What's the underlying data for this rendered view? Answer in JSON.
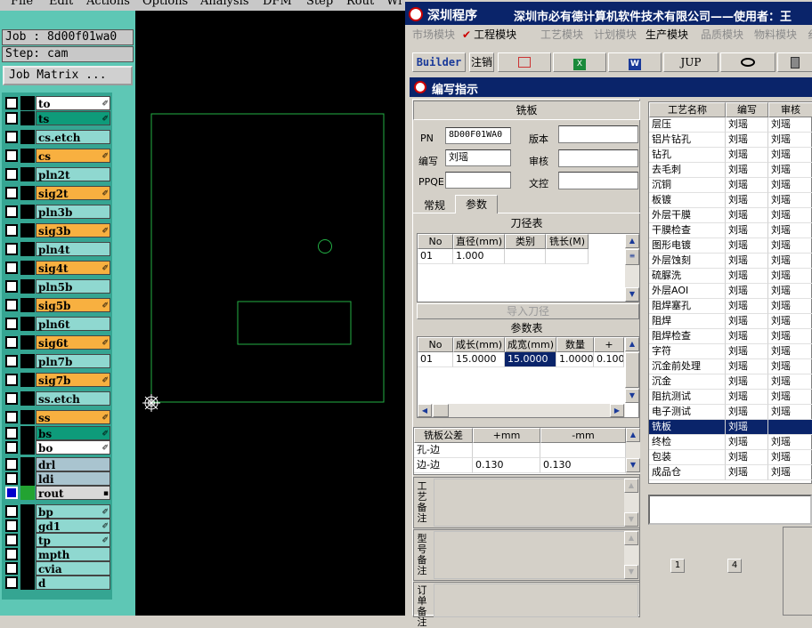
{
  "left_app": {
    "menu": [
      "File",
      "Edit",
      "Actions",
      "Options",
      "Analysis",
      "DFM",
      "Step",
      "Rout",
      "Wi"
    ],
    "job_line": "Job : 8d00f01wa0",
    "step_line": "Step: cam",
    "job_matrix_label": "Job Matrix ...",
    "layers": [
      {
        "name": "to",
        "color": "#ffffff",
        "swatch": "#000000",
        "icon": "✐",
        "checked": false
      },
      {
        "name": "ts",
        "color": "#0e9b7a",
        "swatch": "#000000",
        "icon": "✐",
        "checked": false
      },
      {
        "name": "cs.etch",
        "color": "#8fd8d0",
        "swatch": "#000000",
        "icon": "",
        "checked": false
      },
      {
        "name": "cs",
        "color": "#f8b040",
        "swatch": "#000000",
        "icon": "✐",
        "checked": false
      },
      {
        "name": "pln2t",
        "color": "#8fd8d0",
        "swatch": "#000000",
        "icon": "",
        "checked": false
      },
      {
        "name": "sig2t",
        "color": "#f8b040",
        "swatch": "#000000",
        "icon": "✐",
        "checked": false
      },
      {
        "name": "pln3b",
        "color": "#8fd8d0",
        "swatch": "#000000",
        "icon": "",
        "checked": false
      },
      {
        "name": "sig3b",
        "color": "#f8b040",
        "swatch": "#000000",
        "icon": "✐",
        "checked": false
      },
      {
        "name": "pln4t",
        "color": "#8fd8d0",
        "swatch": "#000000",
        "icon": "",
        "checked": false
      },
      {
        "name": "sig4t",
        "color": "#f8b040",
        "swatch": "#000000",
        "icon": "✐",
        "checked": false
      },
      {
        "name": "pln5b",
        "color": "#8fd8d0",
        "swatch": "#000000",
        "icon": "",
        "checked": false
      },
      {
        "name": "sig5b",
        "color": "#f8b040",
        "swatch": "#000000",
        "icon": "✐",
        "checked": false
      },
      {
        "name": "pln6t",
        "color": "#8fd8d0",
        "swatch": "#000000",
        "icon": "",
        "checked": false
      },
      {
        "name": "sig6t",
        "color": "#f8b040",
        "swatch": "#000000",
        "icon": "✐",
        "checked": false
      },
      {
        "name": "pln7b",
        "color": "#8fd8d0",
        "swatch": "#000000",
        "icon": "",
        "checked": false
      },
      {
        "name": "sig7b",
        "color": "#f8b040",
        "swatch": "#000000",
        "icon": "✐",
        "checked": false
      },
      {
        "name": "ss.etch",
        "color": "#8fd8d0",
        "swatch": "#000000",
        "icon": "",
        "checked": false
      },
      {
        "name": "ss",
        "color": "#f8b040",
        "swatch": "#000000",
        "icon": "✐",
        "checked": false
      },
      {
        "name": "bs",
        "color": "#0e9b7a",
        "swatch": "#000000",
        "icon": "✐",
        "checked": false
      },
      {
        "name": "bo",
        "color": "#ffffff",
        "swatch": "#000000",
        "icon": "✐",
        "checked": false
      },
      {
        "name": "drl",
        "color": "#a9c4cf",
        "swatch": "#000000",
        "icon": "",
        "checked": false
      },
      {
        "name": "ldi",
        "color": "#a9c4cf",
        "swatch": "#000000",
        "icon": "",
        "checked": false
      },
      {
        "name": "rout",
        "color": "#d8d8d8",
        "swatch": "#23a332",
        "icon": "▪",
        "checked": true
      },
      {
        "name": "bp",
        "color": "#8fd8d0",
        "swatch": "#000000",
        "icon": "✐",
        "checked": false
      },
      {
        "name": "gd1",
        "color": "#8fd8d0",
        "swatch": "#000000",
        "icon": "✐",
        "checked": false
      },
      {
        "name": "tp",
        "color": "#8fd8d0",
        "swatch": "#000000",
        "icon": "✐",
        "checked": false
      },
      {
        "name": "mpth",
        "color": "#8fd8d0",
        "swatch": "#000000",
        "icon": "",
        "checked": false
      },
      {
        "name": "cvia",
        "color": "#8fd8d0",
        "swatch": "#000000",
        "icon": "",
        "checked": false
      },
      {
        "name": "d",
        "color": "#8fd8d0",
        "swatch": "#000000",
        "icon": "",
        "checked": false
      }
    ],
    "origin_icon": "crosshair-icon"
  },
  "right_app": {
    "title": "深圳程序",
    "title_company": "深圳市必有德计算机软件技术有限公司——使用者：王",
    "module_tabs": [
      {
        "label": "市场模块",
        "active": false,
        "enabled": false
      },
      {
        "label": "工程模块",
        "active": true,
        "enabled": true
      },
      {
        "label": "工艺模块",
        "active": false,
        "enabled": false
      },
      {
        "label": "计划模块",
        "active": false,
        "enabled": false
      },
      {
        "label": "生产模块",
        "active": false,
        "enabled": true
      },
      {
        "label": "品质模块",
        "active": false,
        "enabled": false
      },
      {
        "label": "物料模块",
        "active": false,
        "enabled": false
      },
      {
        "label": "纟",
        "active": false,
        "enabled": false
      }
    ],
    "toolbar": {
      "builder": "Builder",
      "logout": "注销",
      "jup": "JUP"
    },
    "subwindow_title": "编写指示",
    "form": {
      "header": "铣板",
      "pn_label": "PN",
      "pn_value": "8D00F01WA0",
      "version_label": "版本",
      "version_value": "",
      "author_label": "编写",
      "author_value": "刘瑶",
      "review_label": "审核",
      "review_value": "",
      "ppqe_label": "PPQE",
      "ppqe_value": "",
      "docctrl_label": "文控",
      "docctrl_value": "",
      "tab_general": "常规",
      "tab_params": "参数"
    },
    "tool_table": {
      "title": "刀径表",
      "headers": [
        "No",
        "直径(mm)",
        "类别",
        "铣长(M)"
      ],
      "rows": [
        [
          "01",
          "1.000",
          "",
          ""
        ]
      ],
      "import_label": "导入刀径"
    },
    "param_table": {
      "title": "参数表",
      "headers": [
        "No",
        "成长(mm)",
        "成宽(mm)",
        "数量",
        "+"
      ],
      "rows": [
        [
          "01",
          "15.0000",
          "15.0000",
          "1.0000",
          "0.100"
        ]
      ]
    },
    "tolerance": {
      "headers": [
        "铣板公差",
        "+mm",
        "-mm"
      ],
      "rows": [
        [
          "孔-边",
          "",
          ""
        ],
        [
          "边-边",
          "0.130",
          "0.130"
        ]
      ]
    },
    "notes": {
      "process_note": "工艺备注",
      "model_note": "型号备注",
      "order_note": "订单备注"
    },
    "process_list": {
      "headers": [
        "工艺名称",
        "编写",
        "审核"
      ],
      "selected_index": 20,
      "rows": [
        [
          "层压",
          "刘瑶",
          "刘瑶"
        ],
        [
          "铝片钻孔",
          "刘瑶",
          "刘瑶"
        ],
        [
          "钻孔",
          "刘瑶",
          "刘瑶"
        ],
        [
          "去毛刺",
          "刘瑶",
          "刘瑶"
        ],
        [
          "沉铜",
          "刘瑶",
          "刘瑶"
        ],
        [
          "板镀",
          "刘瑶",
          "刘瑶"
        ],
        [
          "外层干膜",
          "刘瑶",
          "刘瑶"
        ],
        [
          "干膜检查",
          "刘瑶",
          "刘瑶"
        ],
        [
          "图形电镀",
          "刘瑶",
          "刘瑶"
        ],
        [
          "外层蚀刻",
          "刘瑶",
          "刘瑶"
        ],
        [
          "硫脲洗",
          "刘瑶",
          "刘瑶"
        ],
        [
          "外层AOI",
          "刘瑶",
          "刘瑶"
        ],
        [
          "阻焊塞孔",
          "刘瑶",
          "刘瑶"
        ],
        [
          "阻焊",
          "刘瑶",
          "刘瑶"
        ],
        [
          "阻焊检查",
          "刘瑶",
          "刘瑶"
        ],
        [
          "字符",
          "刘瑶",
          "刘瑶"
        ],
        [
          "沉金前处理",
          "刘瑶",
          "刘瑶"
        ],
        [
          "沉金",
          "刘瑶",
          "刘瑶"
        ],
        [
          "阻抗测试",
          "刘瑶",
          "刘瑶"
        ],
        [
          "电子测试",
          "刘瑶",
          "刘瑶"
        ],
        [
          "铣板",
          "刘瑶",
          ""
        ],
        [
          "终检",
          "刘瑶",
          "刘瑶"
        ],
        [
          "包装",
          "刘瑶",
          "刘瑶"
        ],
        [
          "成品仓",
          "刘瑶",
          "刘瑶"
        ]
      ]
    },
    "page_buttons": [
      "1",
      "4"
    ]
  }
}
